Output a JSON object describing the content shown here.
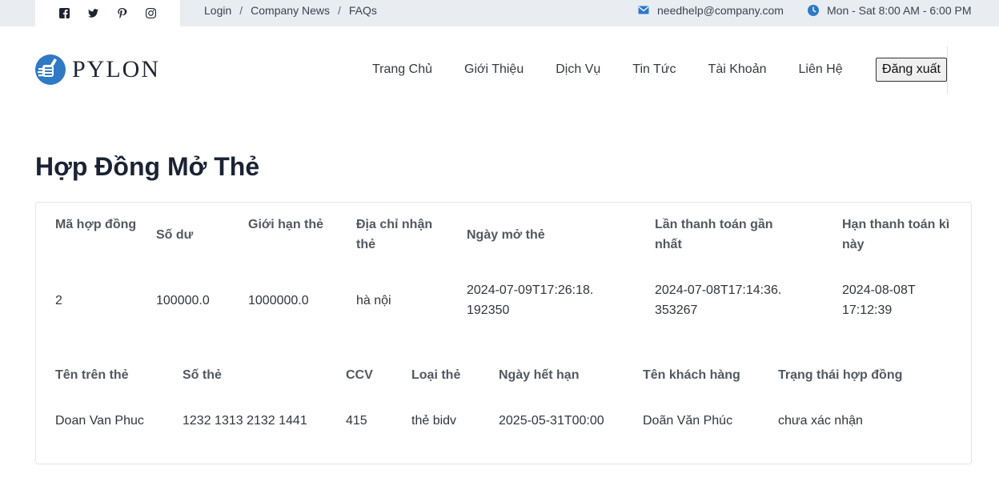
{
  "topbar": {
    "social": [
      {
        "icon": "facebook-icon"
      },
      {
        "icon": "twitter-icon"
      },
      {
        "icon": "pinterest-icon"
      },
      {
        "icon": "instagram-icon"
      }
    ],
    "links": {
      "login": "Login",
      "news": "Company News",
      "faqs": "FAQs",
      "separator": "/"
    },
    "email": "needhelp@company.com",
    "hours": "Mon - Sat 8:00 AM - 6:00 PM"
  },
  "brand": {
    "name": "PYLON"
  },
  "nav": {
    "items": [
      "Trang Chủ",
      "Giới Thiệu",
      "Dịch Vụ",
      "Tin Tức",
      "Tài Khoản",
      "Liên Hệ"
    ],
    "logout": "Đăng xuất"
  },
  "page": {
    "title": "Hợp Đồng Mở Thẻ"
  },
  "table1": {
    "headers": [
      "Mã hợp đồng",
      "Số dư",
      "Giới hạn thẻ",
      "Địa chỉ nhận thẻ",
      "Ngày mở thẻ",
      "Lần thanh toán gần nhất",
      "Hạn thanh toán kì này"
    ],
    "values": [
      "2",
      "100000.0",
      "1000000.0",
      "hà nội",
      "2024-07-09T17:26:18.192350",
      "2024-07-08T17:14:36.353267",
      "2024-08-08T17:12:39"
    ]
  },
  "table2": {
    "headers": [
      "Tên trên thẻ",
      "Số thẻ",
      "CCV",
      "Loại thẻ",
      "Ngày hết hạn",
      "Tên khách hàng",
      "Trạng thái hợp đồng"
    ],
    "values": [
      "Doan Van Phuc",
      "1232 1313 2132 1441",
      "415",
      "thẻ bidv",
      "2025-05-31T00:00",
      "Doãn Văn Phúc",
      "chưa xác nhận"
    ]
  }
}
